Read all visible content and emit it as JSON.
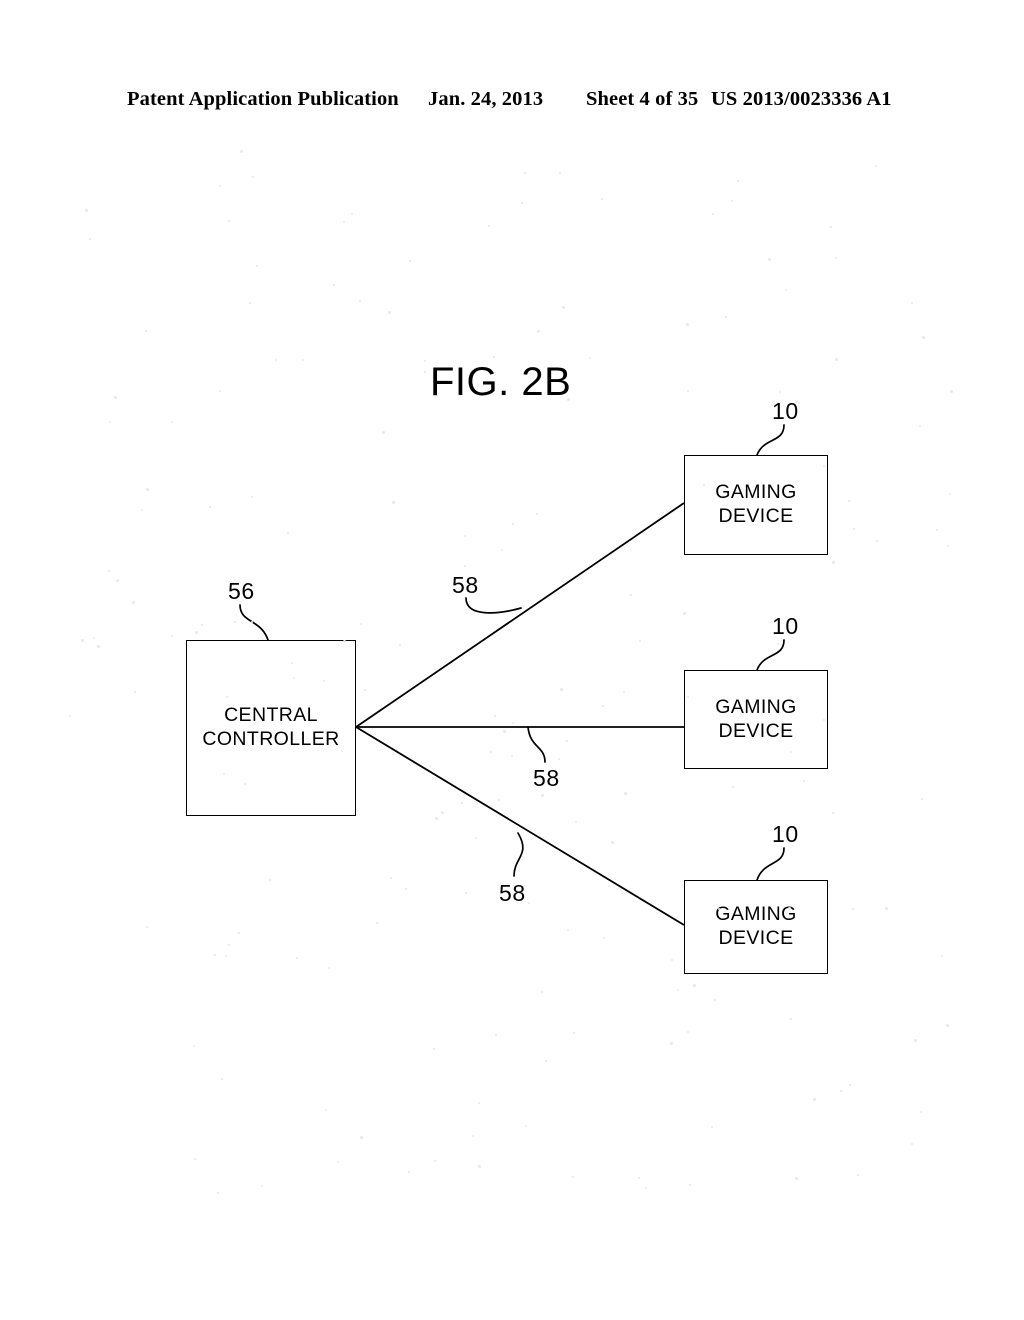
{
  "header": {
    "publication": "Patent Application Publication",
    "date": "Jan. 24, 2013",
    "sheet": "Sheet 4 of 35",
    "patent_number": "US 2013/0023336 A1"
  },
  "figure": {
    "title": "FIG. 2B",
    "nodes": {
      "central_controller": "CENTRAL\nCONTROLLER",
      "gaming_device_1": "GAMING\nDEVICE",
      "gaming_device_2": "GAMING\nDEVICE",
      "gaming_device_3": "GAMING\nDEVICE"
    },
    "reference_numerals": {
      "gaming_device_top": "10",
      "gaming_device_middle": "10",
      "gaming_device_bottom": "10",
      "central_controller": "56",
      "network_link_top": "58",
      "network_link_middle": "58",
      "network_link_bottom": "58"
    }
  },
  "colors": {
    "ink": "#000000",
    "page": "#ffffff"
  }
}
